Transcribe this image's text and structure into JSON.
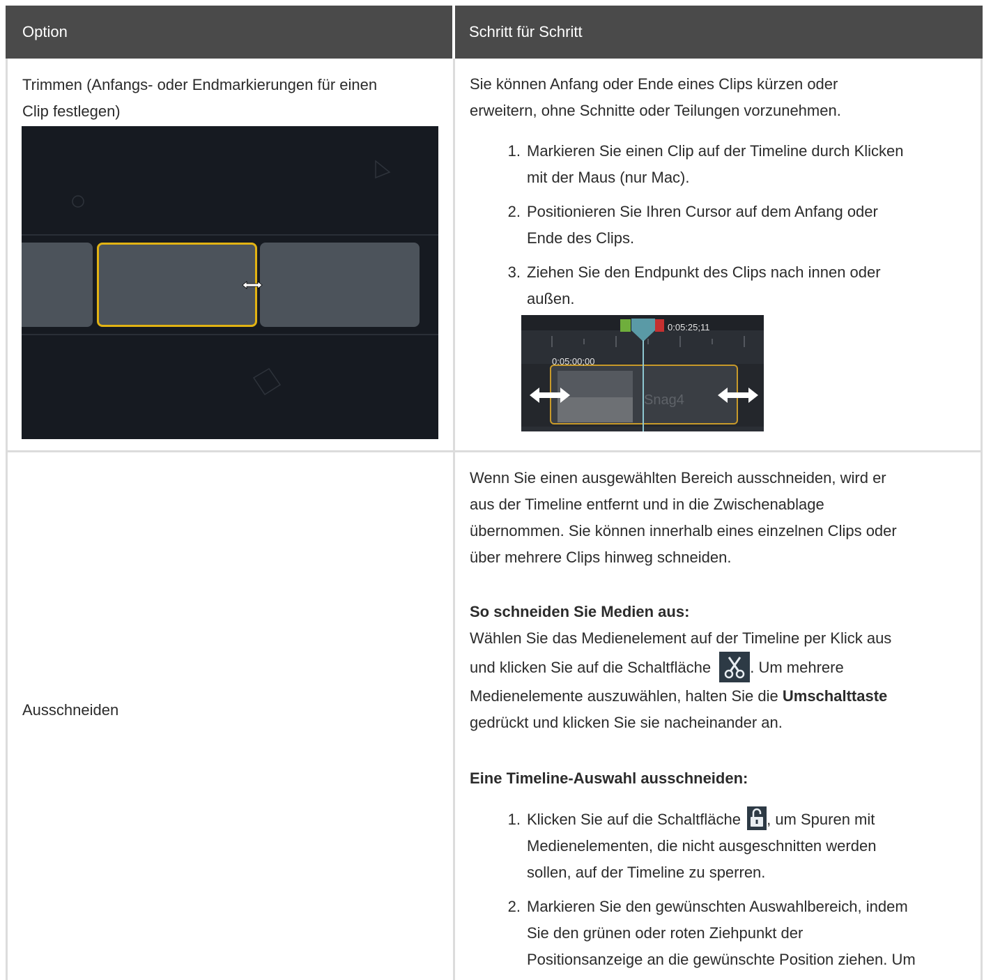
{
  "header": {
    "col1": "Option",
    "col2": "Schritt für Schritt"
  },
  "row1": {
    "option": "Trimmen (Anfangs- oder Endmarkierungen für einen Clip festlegen)",
    "option_line1": "Trimmen (Anfangs- oder Endmarkierungen für einen",
    "option_line2": "Clip festlegen)",
    "intro_line1": "Sie können Anfang oder Ende eines Clips kürzen oder",
    "intro_line2": "erweitern, ohne Schnitte oder Teilungen vorzunehmen.",
    "steps": [
      {
        "num": "1.",
        "line1": "Markieren Sie einen Clip auf der Timeline durch Klicken",
        "line2": "mit der Maus (nur Mac)."
      },
      {
        "num": "2.",
        "line1": "Positionieren Sie Ihren Cursor auf dem Anfang oder",
        "line2": "Ende des Clips."
      },
      {
        "num": "3.",
        "line1": "Ziehen Sie den Endpunkt des Clips nach innen oder",
        "line2": "außen."
      }
    ],
    "timeline": {
      "time_marker": "0:05:25;11",
      "time_start": "0:05:00;00",
      "clip_name": "Snag4"
    }
  },
  "row2": {
    "option": "Ausschneiden",
    "para_lines": [
      "Wenn Sie einen ausgewählten Bereich ausschneiden, wird er",
      "aus der Timeline entfernt und in die Zwischenablage",
      "übernommen. Sie können innerhalb eines einzelnen Clips oder",
      "über mehrere Clips hinweg schneiden."
    ],
    "heading1": "So schneiden Sie Medien aus:",
    "media_line1": "Wählen Sie das Medienelement auf der Timeline per Klick aus",
    "media_line2_a": "und klicken Sie auf die Schaltfläche",
    "media_line2_b": ". Um mehrere",
    "media_line3_a": "Medienelemente auszuwählen, halten Sie die",
    "media_line3_bold": "Umschalttaste",
    "media_line4": "gedrückt und klicken Sie sie nacheinander an.",
    "heading2": "Eine Timeline-Auswahl ausschneiden:",
    "steps": [
      {
        "num": "1.",
        "line1_a": "Klicken Sie auf die Schaltfläche",
        "line1_b": ", um Spuren mit",
        "line2": "Medienelementen, die nicht ausgeschnitten werden",
        "line3": "sollen, auf der Timeline zu sperren."
      },
      {
        "num": "2.",
        "line1": "Markieren Sie den gewünschten Auswahlbereich, indem",
        "line2": "Sie den grünen oder roten Ziehpunkt der",
        "line3": "Positionsanzeige an die gewünschte Position ziehen. Um"
      }
    ]
  },
  "colors": {
    "header_bg": "#4a4a4a",
    "selection_border": "#e2b313",
    "playhead": "#5a9aa6"
  }
}
